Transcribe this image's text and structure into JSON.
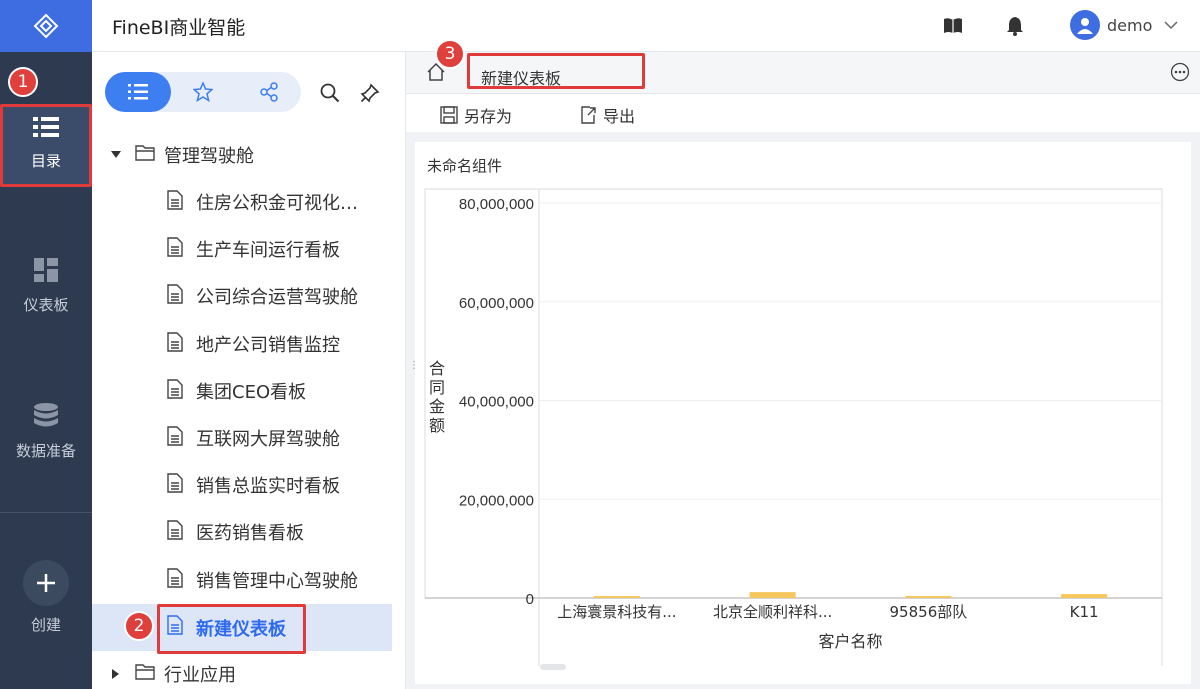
{
  "app": {
    "title": "FineBI商业智能"
  },
  "header": {
    "username": "demo"
  },
  "rail": {
    "items": [
      {
        "label": "目录"
      },
      {
        "label": "仪表板"
      },
      {
        "label": "数据准备"
      },
      {
        "label": "创建"
      }
    ]
  },
  "tree": {
    "root_folder": "管理驾驶舱",
    "items": [
      "住房公积金可视化…",
      "生产车间运行看板",
      "公司综合运营驾驶舱",
      "地产公司销售监控",
      "集团CEO看板",
      "互联网大屏驾驶舱",
      "销售总监实时看板",
      "医药销售看板",
      "销售管理中心驾驶舱",
      "新建仪表板"
    ],
    "second_folder": "行业应用"
  },
  "tab": {
    "name": "新建仪表板"
  },
  "toolbar": {
    "save_as": "另存为",
    "export": "导出"
  },
  "widget": {
    "title": "未命名组件"
  },
  "annotations": {
    "b1": "1",
    "b2": "2",
    "b3": "3"
  },
  "colors": {
    "accent": "#3d7ef0",
    "bar": "#f5c75e",
    "rail": "#2d3a50",
    "annotation": "#e03a3a"
  },
  "chart_data": {
    "type": "bar",
    "xlabel": "客户名称",
    "ylabel": "合同金额",
    "categories": [
      "上海寰景科技有...",
      "北京全顺利祥科...",
      "95856部队",
      "K11"
    ],
    "values": [
      200000,
      1200000,
      150000,
      800000
    ],
    "ylim": [
      0,
      85000000
    ],
    "yticks": [
      "80,000,000",
      "60,000,000",
      "40,000,000",
      "20,000,000",
      "0"
    ],
    "ytick_values": [
      80000000,
      60000000,
      40000000,
      20000000,
      0
    ],
    "grid": true
  }
}
